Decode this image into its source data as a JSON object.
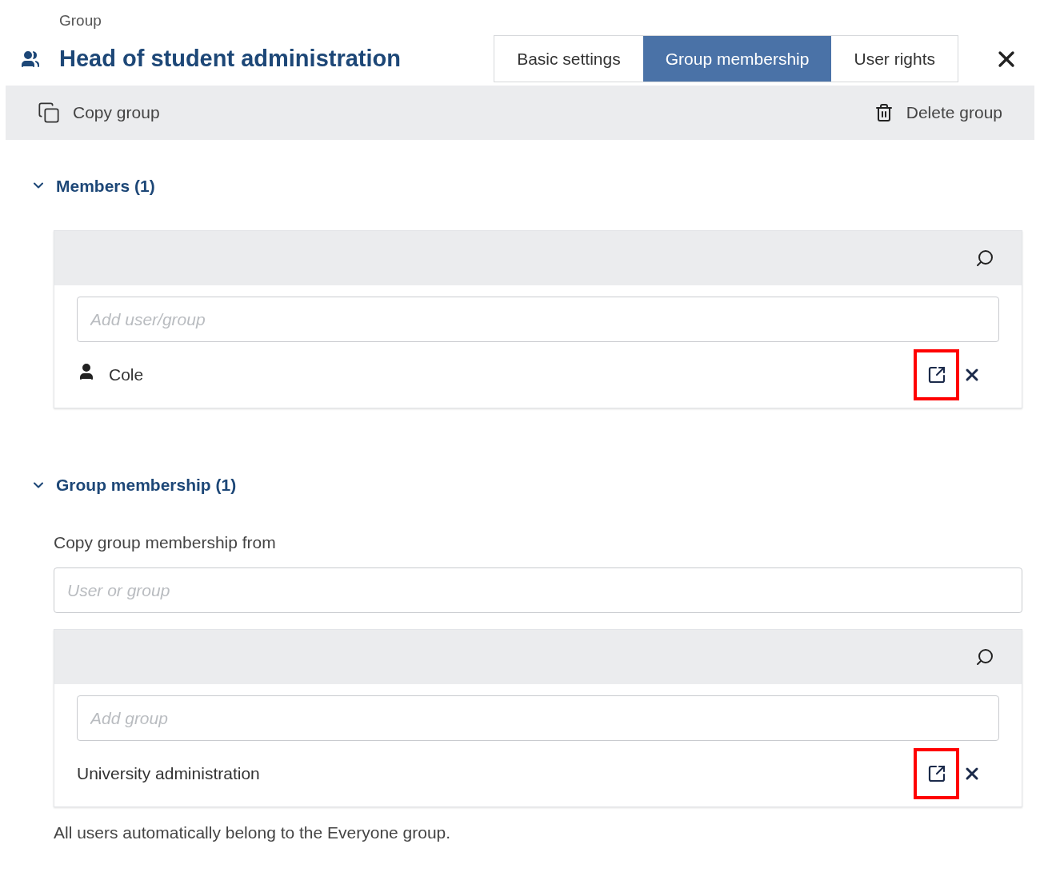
{
  "header": {
    "caption": "Group",
    "title": "Head of student administration"
  },
  "tabs": [
    {
      "label": "Basic settings",
      "selected": false
    },
    {
      "label": "Group membership",
      "selected": true
    },
    {
      "label": "User rights",
      "selected": false
    }
  ],
  "toolbar": {
    "copy": "Copy group",
    "delete": "Delete group"
  },
  "sections": [
    {
      "title": "Members (1)",
      "expanded": true,
      "panel": {
        "placeholder": "Add user/group",
        "items": [
          {
            "name": "Cole",
            "kind": "user",
            "highlighted": true
          }
        ]
      }
    },
    {
      "title": "Group membership (1)",
      "expanded": true,
      "copy_label": "Copy group membership from",
      "copy_placeholder": "User or group",
      "panel": {
        "placeholder": "Add group",
        "items": [
          {
            "name": "University administration",
            "kind": "group",
            "highlighted": true
          }
        ]
      },
      "note": "All users automatically belong to the Everyone group."
    }
  ]
}
